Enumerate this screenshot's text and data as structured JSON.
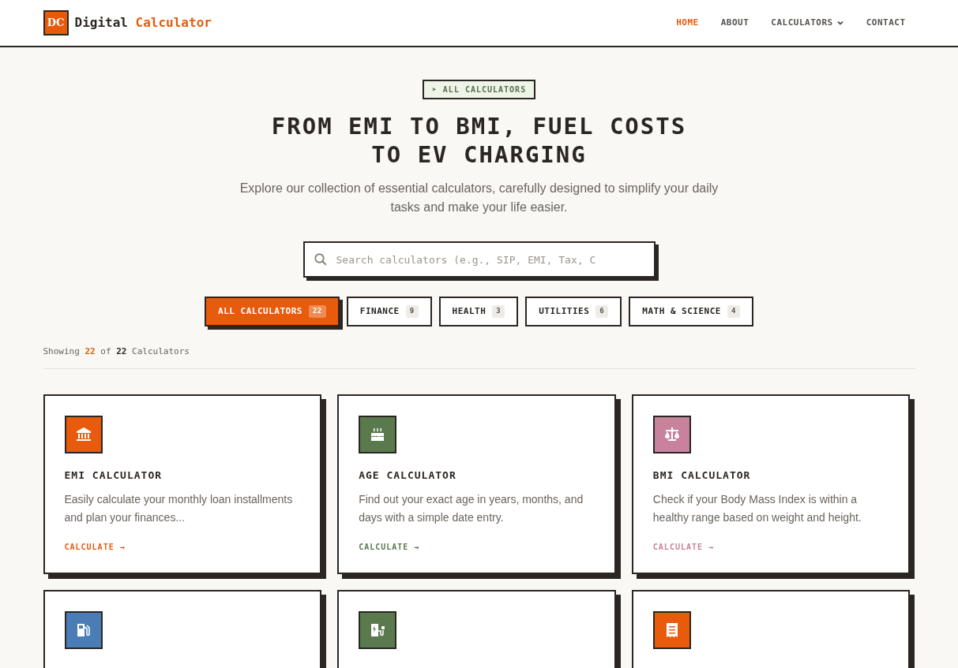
{
  "header": {
    "logo_mark": "DC",
    "logo_word": "Digital",
    "logo_accent": "Calculator",
    "nav": [
      {
        "label": "HOME",
        "selected": true,
        "dropdown": false
      },
      {
        "label": "ABOUT",
        "selected": false,
        "dropdown": false
      },
      {
        "label": "CALCULATORS",
        "selected": false,
        "dropdown": true
      },
      {
        "label": "CONTACT",
        "selected": false,
        "dropdown": false
      }
    ]
  },
  "hero": {
    "badge": "➤ ALL CALCULATORS",
    "title_lines": [
      "FROM EMI TO BMI, FUEL COSTS",
      "TO EV CHARGING"
    ],
    "subtitle": "Explore our collection of essential calculators, carefully designed to simplify your daily tasks and make your life easier."
  },
  "search": {
    "placeholder": "Search calculators (e.g., SIP, EMI, Tax, C"
  },
  "filters": [
    {
      "label": "ALL CALCULATORS",
      "count": "22",
      "selected": true
    },
    {
      "label": "FINANCE",
      "count": "9",
      "selected": false
    },
    {
      "label": "HEALTH",
      "count": "3",
      "selected": false
    },
    {
      "label": "UTILITIES",
      "count": "6",
      "selected": false
    },
    {
      "label": "MATH & SCIENCE",
      "count": "4",
      "selected": false
    }
  ],
  "results": {
    "prefix": "Showing",
    "shown": "22",
    "middle": "of",
    "total": "22",
    "suffix": "Calculators"
  },
  "cards": [
    {
      "kind": "bank",
      "color": "#e85a0c",
      "title": "EMI CALCULATOR",
      "description": "Easily calculate your monthly loan installments and plan your finances...",
      "link": "CALCULATE →"
    },
    {
      "kind": "cake",
      "color": "#5a7a4e",
      "title": "AGE CALCULATOR",
      "description": "Find out your exact age in years, months, and days with a simple date entry.",
      "link": "CALCULATE →"
    },
    {
      "kind": "scale",
      "color": "#c9829c",
      "title": "BMI CALCULATOR",
      "description": "Check if your Body Mass Index is within a healthy range based on weight and height.",
      "link": "CALCULATE →"
    },
    {
      "kind": "fuel",
      "color": "#4a7db5"
    },
    {
      "kind": "charger",
      "color": "#5a7a4e"
    },
    {
      "kind": "receipt",
      "color": "#e85a0c"
    }
  ]
}
